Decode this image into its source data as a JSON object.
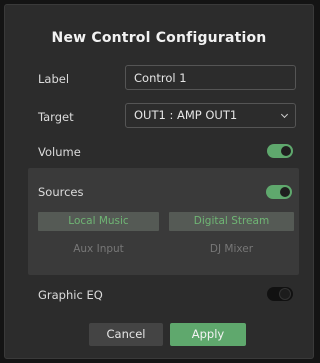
{
  "dialog": {
    "title": "New Control Configuration",
    "label": {
      "text": "Label",
      "value": "Control 1"
    },
    "target": {
      "text": "Target",
      "selected": "OUT1 : AMP OUT1"
    },
    "volume": {
      "text": "Volume",
      "enabled": true
    },
    "sources": {
      "text": "Sources",
      "enabled": true,
      "options": [
        {
          "label": "Local Music",
          "selected": true
        },
        {
          "label": "Digital Stream",
          "selected": true
        },
        {
          "label": "Aux Input",
          "selected": false
        },
        {
          "label": "DJ Mixer",
          "selected": false
        }
      ]
    },
    "graphic_eq": {
      "text": "Graphic EQ",
      "enabled": false
    },
    "buttons": {
      "cancel": "Cancel",
      "apply": "Apply"
    }
  },
  "colors": {
    "accent": "#5fa86d",
    "background": "#2c2c2c",
    "panel": "#3a3a3a"
  }
}
